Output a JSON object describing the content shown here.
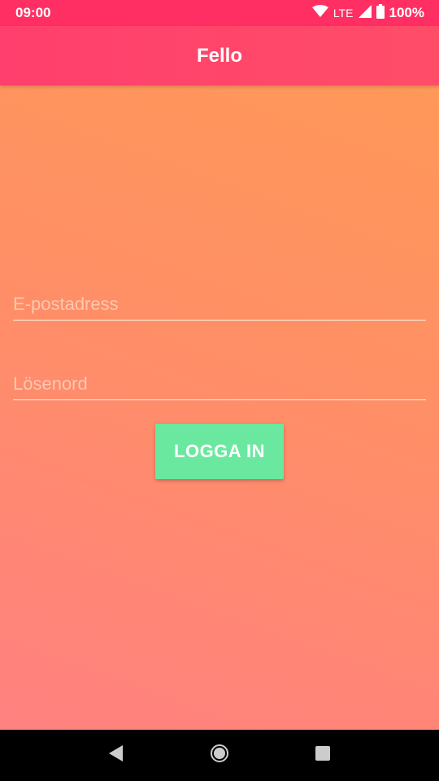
{
  "status_bar": {
    "time": "09:00",
    "network": "LTE",
    "battery": "100%",
    "icons": [
      "wifi-icon",
      "signal-icon",
      "battery-icon"
    ]
  },
  "app_bar": {
    "title": "Fello"
  },
  "login_form": {
    "email": {
      "placeholder": "E-postadress",
      "value": ""
    },
    "password": {
      "placeholder": "Lösenord",
      "value": ""
    },
    "submit_label": "LOGGA IN"
  },
  "nav_bar": {
    "icons": [
      "back-icon",
      "home-icon",
      "recents-icon"
    ]
  },
  "colors": {
    "status_bar": "#ff2f63",
    "app_bar": "#ff4468",
    "background_top": "#ff9a55",
    "background_bottom": "#ff7f83",
    "button": "#6be89f"
  }
}
